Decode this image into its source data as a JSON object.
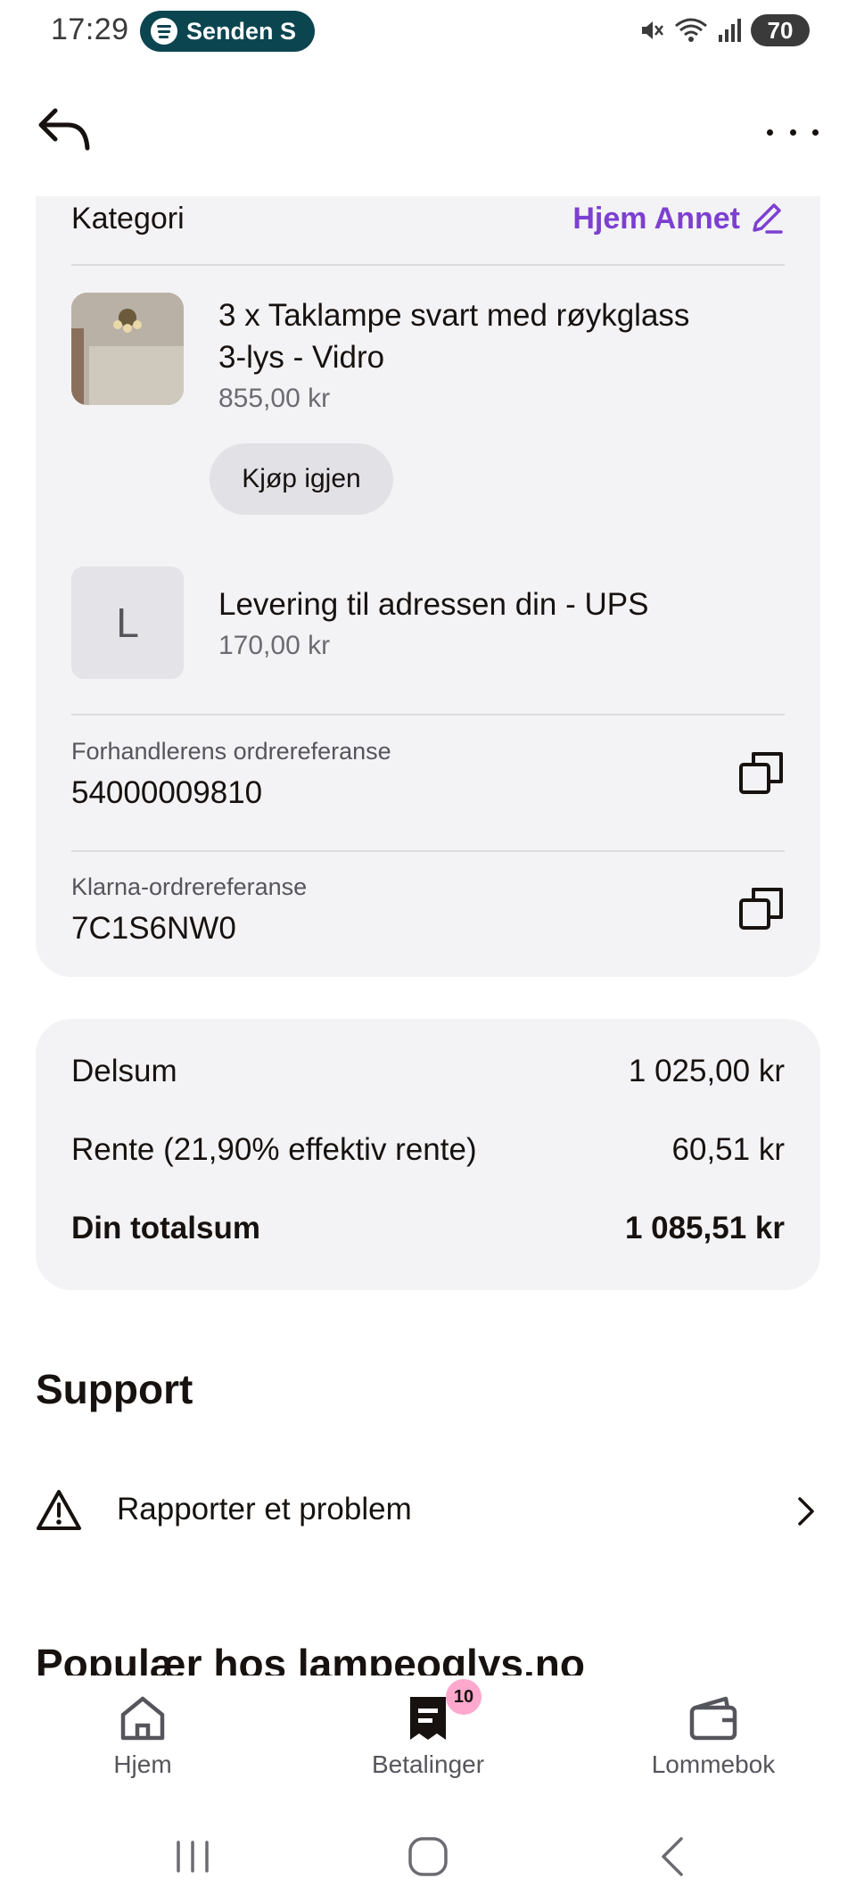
{
  "status_bar": {
    "time": "17:29",
    "now_playing": "Senden S",
    "battery": "70",
    "icons": [
      "spotify-icon",
      "mute-icon",
      "wifi-icon",
      "signal-icon",
      "battery-icon"
    ]
  },
  "header": {
    "back_icon": "back-arrow-icon",
    "menu_icon": "more-dots-icon"
  },
  "order": {
    "category_label": "Kategori",
    "category_value": "Hjem Annet",
    "item": {
      "title_line1": "3 x Taklampe svart med røykglass",
      "title_line2": "3-lys - Vidro",
      "price": "855,00 kr",
      "rebuy_label": "Kjøp igjen"
    },
    "shipping": {
      "tile_letter": "L",
      "title": "Levering til adressen din - UPS",
      "price": "170,00 kr"
    },
    "merchant_ref_label": "Forhandlerens ordrereferanse",
    "merchant_ref_value": "54000009810",
    "klarna_ref_label": "Klarna-ordrereferanse",
    "klarna_ref_value": "7C1S6NW0"
  },
  "summary": {
    "subtotal_label": "Delsum",
    "subtotal_value": "1 025,00 kr",
    "interest_label": "Rente (21,90% effektiv rente)",
    "interest_value": "60,51 kr",
    "total_label": "Din totalsum",
    "total_value": "1 085,51 kr"
  },
  "support": {
    "heading": "Support",
    "report_label": "Rapporter et problem"
  },
  "popular_heading": "Populær hos lampeoglys.no",
  "tabs": [
    {
      "label": "Hjem",
      "icon": "home-icon"
    },
    {
      "label": "Betalinger",
      "icon": "receipt-icon",
      "badge": "10"
    },
    {
      "label": "Lommebok",
      "icon": "wallet-icon"
    }
  ],
  "colors": {
    "accent": "#7d3fd2",
    "card": "#f3f3f5",
    "badge": "#ffa8cd",
    "spotify_pill": "#0b4550"
  }
}
